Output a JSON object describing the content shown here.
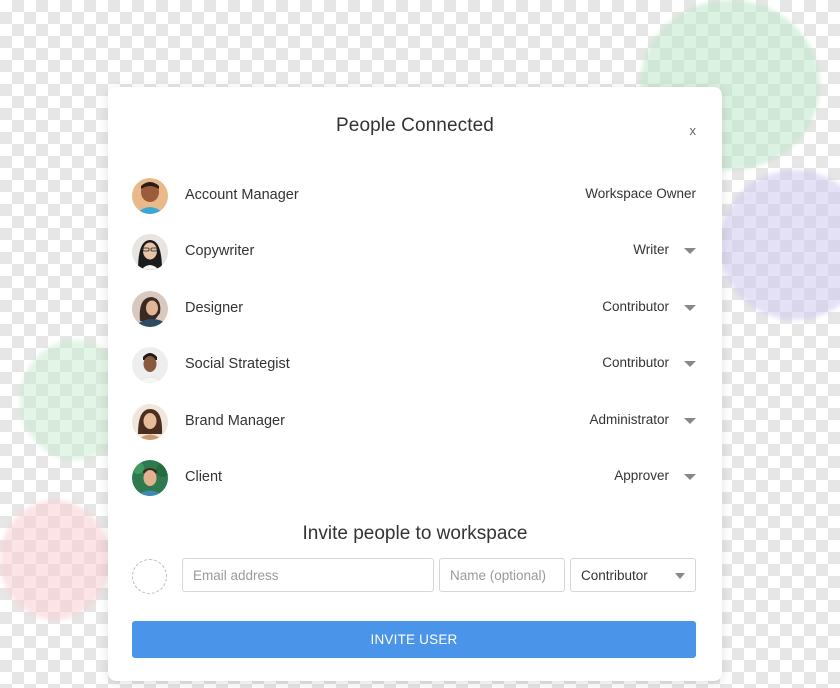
{
  "modal": {
    "title": "People Connected",
    "close_label": "x"
  },
  "people": [
    {
      "name": "Account Manager",
      "role": "Workspace Owner",
      "has_dropdown": false
    },
    {
      "name": "Copywriter",
      "role": "Writer",
      "has_dropdown": true
    },
    {
      "name": "Designer",
      "role": "Contributor",
      "has_dropdown": true
    },
    {
      "name": "Social Strategist",
      "role": "Contributor",
      "has_dropdown": true
    },
    {
      "name": "Brand Manager",
      "role": "Administrator",
      "has_dropdown": true
    },
    {
      "name": "Client",
      "role": "Approver",
      "has_dropdown": true
    }
  ],
  "invite": {
    "title": "Invite people to workspace",
    "email_placeholder": "Email address",
    "name_placeholder": "Name (optional)",
    "role_selected": "Contributor",
    "button_label": "INVITE USER"
  },
  "colors": {
    "accent": "#4a95e9"
  },
  "icons": {
    "caret": "chevron-down-icon",
    "avatar_placeholder": "avatar-placeholder-icon"
  }
}
